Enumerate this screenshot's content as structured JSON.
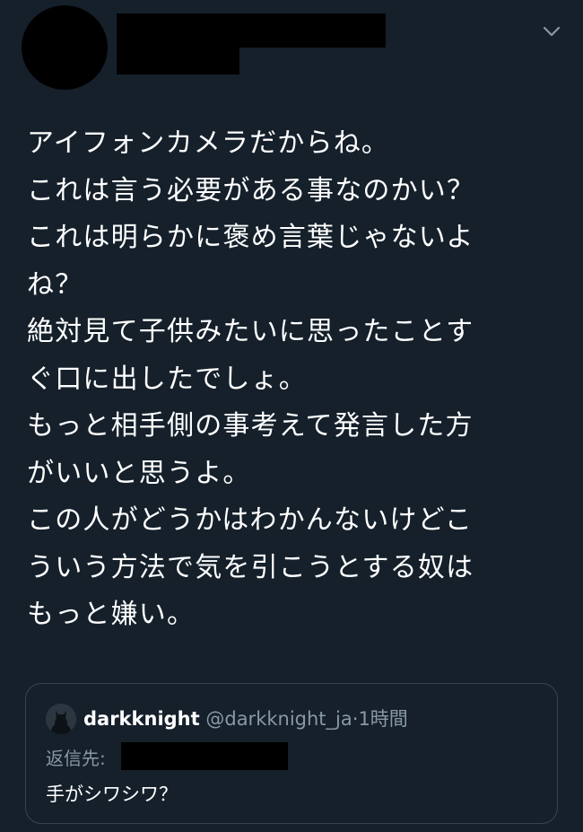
{
  "tweet": {
    "lines": [
      "アイフォンカメラだからね。",
      "これは言う必要がある事なのかい？",
      "これは明らかに褒め言葉じゃないよ",
      "ね？",
      "絶対見て子供みたいに思ったことす",
      "ぐ口に出したでしょ。",
      "もっと相手側の事考えて発言した方",
      "がいいと思うよ。",
      "この人がどうかはわかんないけどこ",
      "ういう方法で気を引こうとする奴は",
      "もっと嫌い。"
    ]
  },
  "quoted": {
    "name": "darkknight",
    "handle": "@darkknight_ja",
    "dot": "·",
    "time": "1時間",
    "reply_label": "返信先:",
    "text": "手がシワシワ？"
  },
  "icons": {
    "menu": "chevron-down-icon",
    "quoted_avatar": "batman-avatar"
  },
  "colors": {
    "background": "#15202b",
    "text": "#ffffff",
    "secondary_text": "#8899a6",
    "border": "#38444d",
    "redaction": "#000000"
  }
}
